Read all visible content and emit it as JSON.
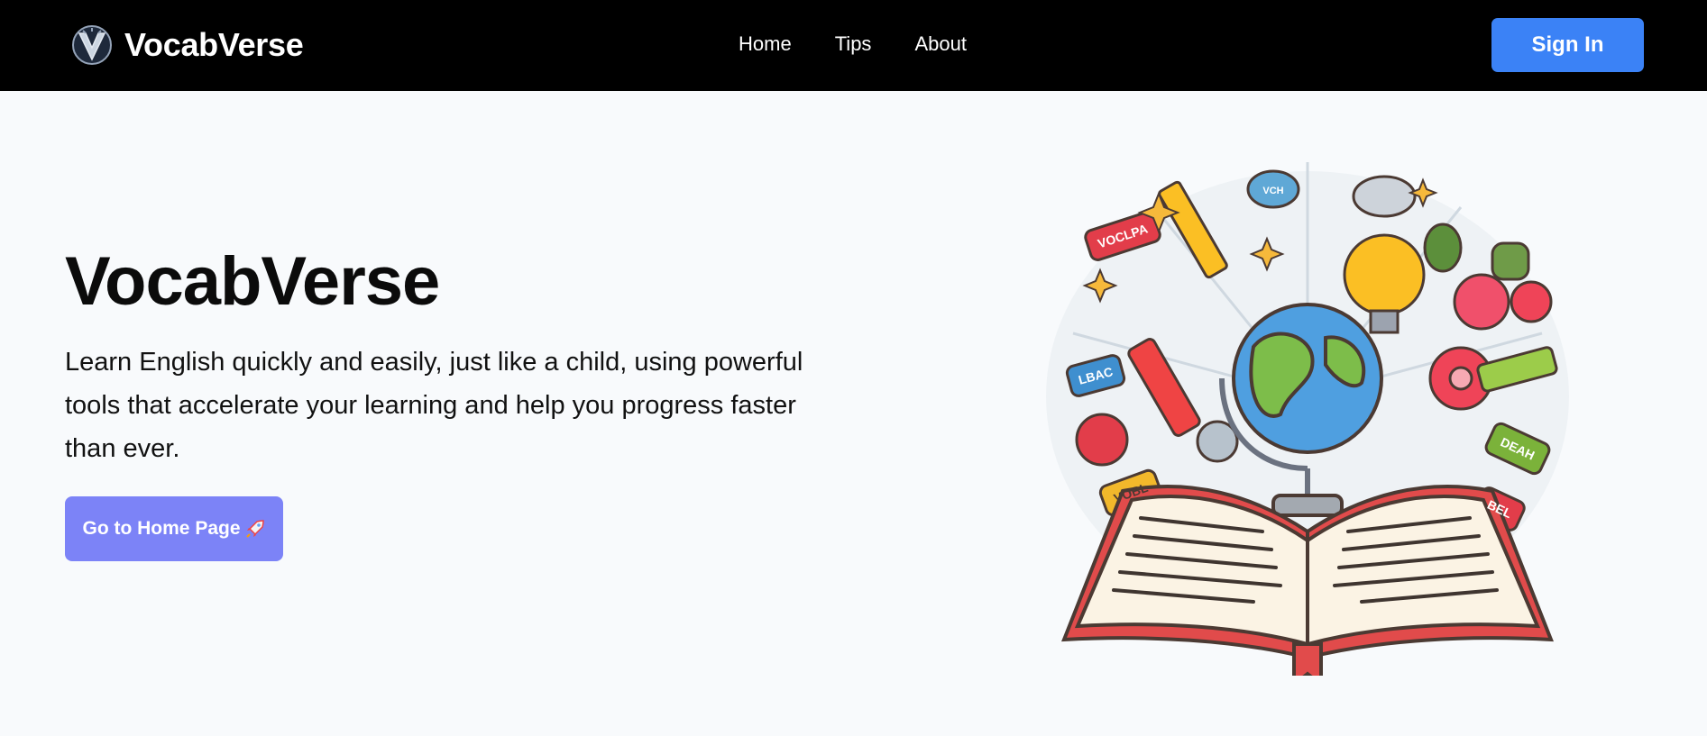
{
  "header": {
    "brand": "VocabVerse",
    "logo_icon": "v-shield-logo-icon",
    "nav": [
      {
        "label": "Home"
      },
      {
        "label": "Tips"
      },
      {
        "label": "About"
      }
    ],
    "signin_label": "Sign In"
  },
  "hero": {
    "title": "VocabVerse",
    "description": "Learn English quickly and easily, just like a child, using powerful tools that accelerate your learning and help you progress faster than ever.",
    "cta_label": "Go to Home Page",
    "cta_icon": "rocket-icon",
    "illustration_icon": "open-book-globe-illustration",
    "illustration_tags": [
      "VOCLPA",
      "VCH",
      "LBAC",
      "VOBL",
      "DEAH",
      "BEL"
    ]
  },
  "colors": {
    "header_bg": "#000000",
    "page_bg": "#f8fafc",
    "signin_bg": "#3b82f6",
    "cta_bg": "#7c83f7"
  }
}
